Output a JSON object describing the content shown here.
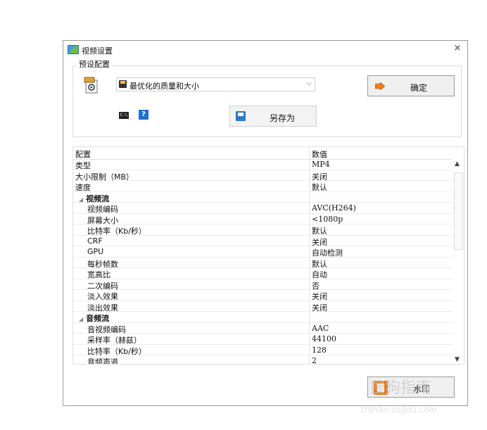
{
  "window": {
    "title": "视频设置",
    "close_icon": "×"
  },
  "preset": {
    "group_label": "预设配置",
    "selected": "最优化的质量和大小",
    "ok_label": "确定",
    "save_as_label": "另存为",
    "cmd_icon_text": "C:\\",
    "help_icon_text": "?"
  },
  "grid": {
    "header": {
      "name": "配置",
      "value": "数值"
    },
    "rows": [
      {
        "name": "类型",
        "value": "MP4",
        "kind": "top"
      },
      {
        "name": "大小限制（MB）",
        "value": "关闭",
        "kind": "top"
      },
      {
        "name": "速度",
        "value": "默认",
        "kind": "top"
      },
      {
        "name": "视频流",
        "value": "",
        "kind": "cat"
      },
      {
        "name": "视频编码",
        "value": "AVC(H264)",
        "kind": "indent"
      },
      {
        "name": "屏幕大小",
        "value": "<1080p",
        "kind": "indent"
      },
      {
        "name": "比特率（Kb/秒）",
        "value": "默认",
        "kind": "indent"
      },
      {
        "name": "CRF",
        "value": "关闭",
        "kind": "indent"
      },
      {
        "name": "GPU",
        "value": "自动检测",
        "kind": "indent"
      },
      {
        "name": "每秒帧数",
        "value": "默认",
        "kind": "indent"
      },
      {
        "name": "宽高比",
        "value": "自动",
        "kind": "indent"
      },
      {
        "name": "二次编码",
        "value": "否",
        "kind": "indent"
      },
      {
        "name": "淡入效果",
        "value": "关闭",
        "kind": "indent"
      },
      {
        "name": "淡出效果",
        "value": "关闭",
        "kind": "indent"
      },
      {
        "name": "音频流",
        "value": "",
        "kind": "cat"
      },
      {
        "name": "音视频编码",
        "value": "AAC",
        "kind": "indent"
      },
      {
        "name": "采样率（赫兹）",
        "value": "44100",
        "kind": "indent"
      },
      {
        "name": "比特率（Kb/秒）",
        "value": "128",
        "kind": "indent"
      },
      {
        "name": "音频声道",
        "value": "2",
        "kind": "indent"
      }
    ]
  },
  "watermark_button": {
    "label": "水印"
  },
  "overlay_watermark": {
    "text": "搜狗指南",
    "sub": "zhinan.sogou.com"
  },
  "colors": {
    "accent": "#e07b1f",
    "help_blue": "#1d6fd3"
  }
}
